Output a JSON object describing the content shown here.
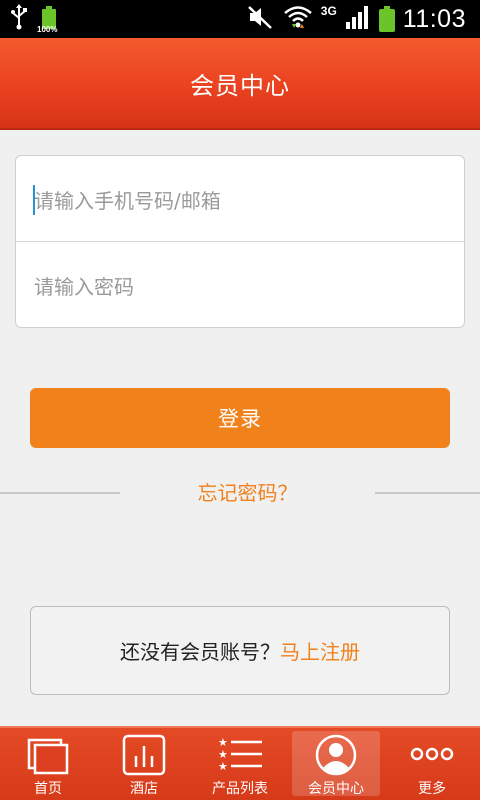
{
  "status_bar": {
    "battery_small_pct": "100%",
    "network": "3G",
    "time": "11:03"
  },
  "header": {
    "title": "会员中心"
  },
  "login": {
    "phone_placeholder": "请输入手机号码/邮箱",
    "password_placeholder": "请输入密码",
    "submit_label": "登录"
  },
  "forgot": {
    "label": "忘记密码？"
  },
  "register": {
    "prompt": "还没有会员账号？",
    "link": "马上注册"
  },
  "bottom_nav": {
    "items": [
      {
        "label": "首页",
        "icon": "home-windows-icon"
      },
      {
        "label": "酒店",
        "icon": "hotel-bars-icon"
      },
      {
        "label": "产品列表",
        "icon": "star-list-icon"
      },
      {
        "label": "会员中心",
        "icon": "person-icon",
        "active": true
      },
      {
        "label": "更多",
        "icon": "more-dots-icon"
      }
    ]
  },
  "colors": {
    "header_red": "#e8401f",
    "accent_orange": "#f1811b",
    "background": "#f0f0f0"
  }
}
